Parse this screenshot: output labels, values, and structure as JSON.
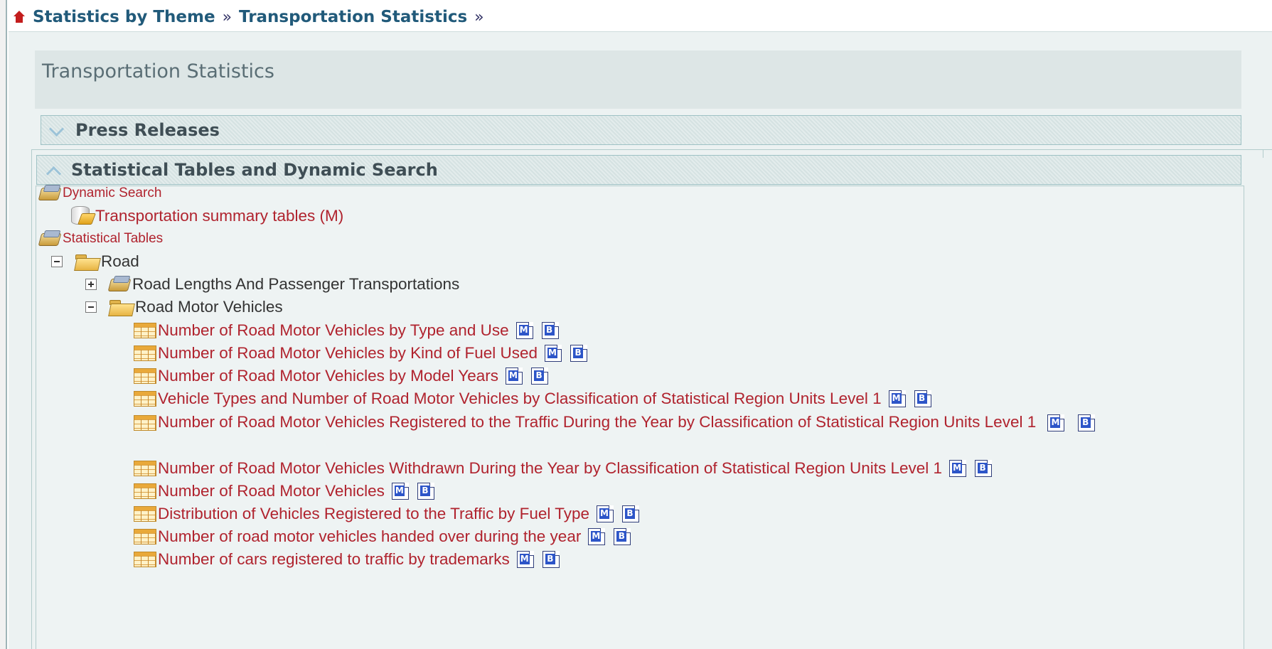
{
  "breadcrumb": {
    "items": [
      "Statistics by Theme",
      "Transportation Statistics"
    ],
    "separator": "»"
  },
  "page": {
    "title": "Transportation Statistics"
  },
  "sections": {
    "press_releases": {
      "label": "Press Releases",
      "state": "collapsed"
    },
    "statistical_tables": {
      "label": "Statistical Tables and Dynamic Search",
      "state": "expanded"
    }
  },
  "tree": {
    "dynamic_search": "Dynamic Search",
    "summary_tables": "Transportation summary tables (M)",
    "statistical_tables": "Statistical Tables",
    "road": "Road",
    "road_lengths": "Road Lengths And Passenger Transportations",
    "road_motor_vehicles": "Road Motor Vehicles",
    "items": [
      "Number of Road Motor Vehicles by Type and Use",
      "Number of Road Motor Vehicles by Kind of Fuel Used",
      "Number of Road Motor Vehicles by Model Years",
      "Vehicle Types and Number of Road Motor Vehicles by Classification of Statistical Region Units Level 1",
      "Number of Road Motor Vehicles Registered to the Traffic During the Year by Classification of Statistical Region Units Level 1",
      "Number of Road Motor Vehicles Withdrawn During the Year by Classification of Statistical Region Units Level 1",
      "Number of Road Motor Vehicles",
      "Distribution of Vehicles Registered to the Traffic by Fuel Type",
      "Number of road motor vehicles handed over during the year",
      "Number of cars registered to traffic by trademarks"
    ],
    "doc_icons": {
      "metadata": "M",
      "bulletin": "B"
    }
  },
  "colors": {
    "link": "#b0232e",
    "header_text": "#215a7a",
    "panel_bg": "#ecf2f2"
  }
}
